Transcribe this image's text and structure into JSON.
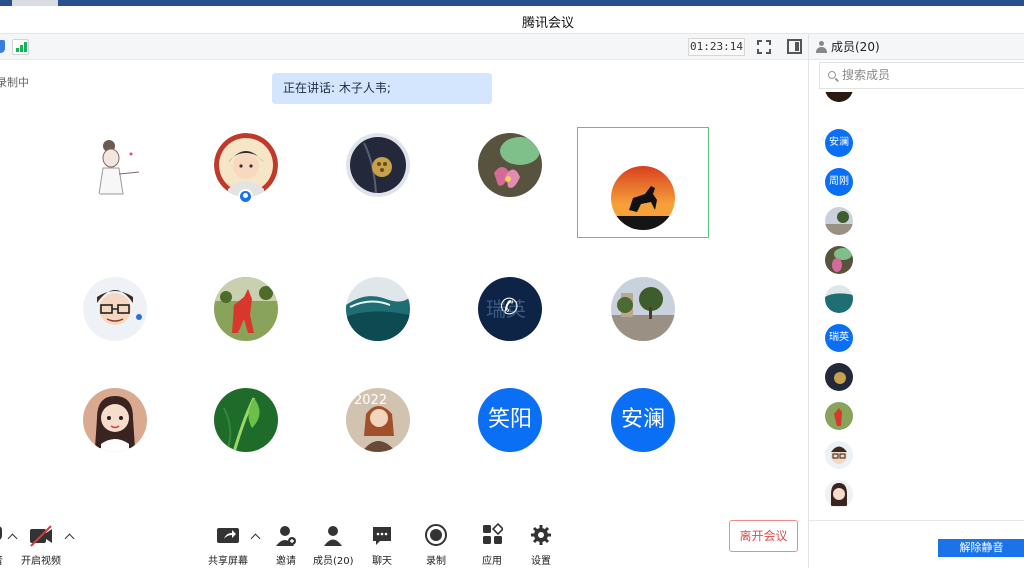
{
  "window": {
    "title": "腾讯会议"
  },
  "toolbar": {
    "timer": "01:23:14"
  },
  "status": {
    "recording": "录制中",
    "speaking": "正在讲话: 木子人韦;"
  },
  "grid": [
    {
      "name": "avatar-sketch-girl",
      "kind": "image"
    },
    {
      "name": "avatar-boy-red-ring",
      "kind": "image",
      "host": true
    },
    {
      "name": "avatar-lotus-pod",
      "kind": "image"
    },
    {
      "name": "avatar-flower-pink",
      "kind": "image"
    },
    {
      "name": "avatar-horse-sunset",
      "kind": "image",
      "active": true
    },
    {
      "name": "avatar-glasses-man",
      "kind": "image"
    },
    {
      "name": "avatar-deer-statue",
      "kind": "image"
    },
    {
      "name": "avatar-ocean-wave",
      "kind": "image"
    },
    {
      "name": "avatar-phone-瑞英",
      "kind": "phone",
      "text": "瑞英"
    },
    {
      "name": "avatar-street-trees",
      "kind": "image"
    },
    {
      "name": "avatar-cartoon-girl",
      "kind": "image"
    },
    {
      "name": "avatar-green-leaf",
      "kind": "image"
    },
    {
      "name": "avatar-girl-2022",
      "kind": "image"
    },
    {
      "name": "avatar-笑阳",
      "kind": "text",
      "text": "笑阳"
    },
    {
      "name": "avatar-安澜",
      "kind": "text",
      "text": "安澜"
    }
  ],
  "bottom": {
    "audio_label": "音",
    "video_label": "开启视频",
    "share_label": "共享屏幕",
    "invite_label": "邀请",
    "members_label": "成员(20)",
    "chat_label": "聊天",
    "record_label": "录制",
    "apps_label": "应用",
    "settings_label": "设置",
    "leave_label": "离开会议"
  },
  "sidebar": {
    "title": "成员(20)",
    "search_placeholder": "搜索成员",
    "members": [
      {
        "kind": "image",
        "name": "member-orange"
      },
      {
        "kind": "text",
        "text": "安澜"
      },
      {
        "kind": "text",
        "text": "周刚"
      },
      {
        "kind": "image",
        "name": "member-street"
      },
      {
        "kind": "image",
        "name": "member-flower"
      },
      {
        "kind": "image",
        "name": "member-wave"
      },
      {
        "kind": "text",
        "text": "瑞英"
      },
      {
        "kind": "image",
        "name": "member-lotus"
      },
      {
        "kind": "image",
        "name": "member-deer"
      },
      {
        "kind": "image",
        "name": "member-glasses"
      },
      {
        "kind": "image",
        "name": "member-cartoon"
      }
    ],
    "unmute_label": "解除静音"
  },
  "colors": {
    "accent": "#0b6ff5",
    "leave": "#e24b4b",
    "active": "#56c77f"
  }
}
